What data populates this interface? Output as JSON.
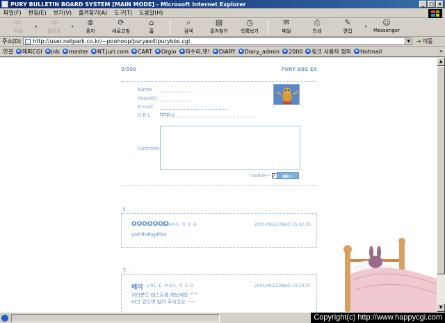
{
  "window": {
    "title": "PURY BULLETIN BOARD SYSTEM [MAIN MODE] - Microsoft Internet Explorer",
    "btn_min": "_",
    "btn_max": "□",
    "btn_close": "×"
  },
  "menu": [
    "파일(F)",
    "편집(E)",
    "보기(V)",
    "즐겨찾기(A)",
    "도구(T)",
    "도움말(H)"
  ],
  "toolbar": {
    "back": "뒤로",
    "forward": "앞으로",
    "stop": "중지",
    "refresh": "새로고침",
    "home": "홈",
    "search": "검색",
    "favorites": "즐겨찾기",
    "history": "목록보기",
    "mail": "메일",
    "print": "인쇄",
    "edit": "편집",
    "messenger": "Messenger"
  },
  "address": {
    "label": "주소(D)",
    "url": "http://user.netpark.co.kr/~poohoop/puryex4/purybbs.cgi",
    "go": "이동"
  },
  "links": {
    "label": "연결",
    "items": [
      "해피CGI",
      "job",
      "master",
      "NT.juri.com",
      "CART",
      "Orgio",
      "차수리,댓!",
      "DIARY",
      "Diary_admin",
      "2000",
      "링크 사용자 정의",
      "Hotmail"
    ],
    "more": "»"
  },
  "board": {
    "count": "3/500",
    "name": "PURY BBS EX",
    "form": {
      "name_label": "Name",
      "pass_label": "PassWD",
      "email_label": "E-mail",
      "url_label": "U.R.L",
      "url_value": "http://",
      "comment_label": "Comment",
      "cookie_label": "cookie~",
      "cookie_check": "✓",
      "ok_label": "ok~"
    },
    "entries": [
      {
        "num": "4 .",
        "name": "OOOOOOO",
        "meta": "E-MAIL R E D",
        "date": "2001/08/22(Wed) 15:02:16",
        "body": [
          "ytrhfhdhgdfhd"
        ]
      },
      {
        "num": "3 .",
        "name": "베이",
        "meta": "URL E-MAIL R E D",
        "date": "2001/08/22(Wed) 10:50:37",
        "body": [
          "여러분도 테스트를 해보세요 ^^",
          "버그 있으면 알려 주시고요 ~~"
        ]
      }
    ]
  },
  "status": {
    "copyright": "Copyright(c) http://www.happycgi.com"
  },
  "colors": {
    "accent": "#4b86c6",
    "title_bar": "#0a246a"
  }
}
